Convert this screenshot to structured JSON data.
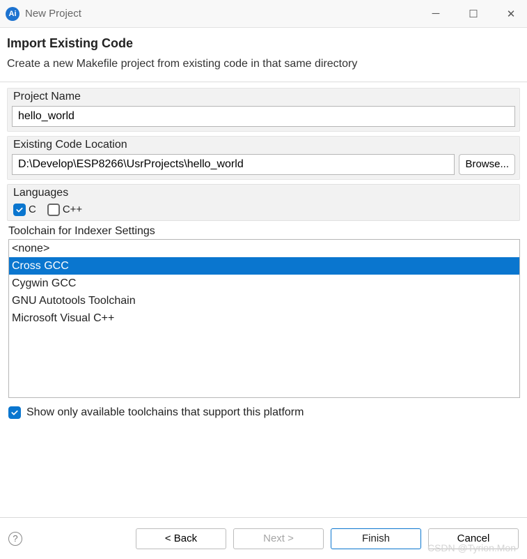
{
  "window": {
    "title": "New Project",
    "app_icon_text": "Ai"
  },
  "header": {
    "title": "Import Existing Code",
    "description": "Create a new Makefile project from existing code in that same directory"
  },
  "project_name": {
    "label": "Project Name",
    "value": "hello_world"
  },
  "existing_code": {
    "label": "Existing Code Location",
    "value": "D:\\Develop\\ESP8266\\UsrProjects\\hello_world",
    "browse_label": "Browse..."
  },
  "languages": {
    "label": "Languages",
    "items": [
      {
        "name": "c",
        "label": "C",
        "checked": true
      },
      {
        "name": "cpp",
        "label": "C++",
        "checked": false
      }
    ]
  },
  "toolchain": {
    "label": "Toolchain for Indexer Settings",
    "items": [
      {
        "label": "<none>",
        "selected": false
      },
      {
        "label": "Cross GCC",
        "selected": true
      },
      {
        "label": "Cygwin GCC",
        "selected": false
      },
      {
        "label": "GNU Autotools Toolchain",
        "selected": false
      },
      {
        "label": "Microsoft Visual C++",
        "selected": false
      }
    ]
  },
  "show_only": {
    "checked": true,
    "label": "Show only available toolchains that support this platform"
  },
  "footer": {
    "back": "< Back",
    "next": "Next >",
    "finish": "Finish",
    "cancel": "Cancel"
  },
  "watermark": "CSDN @Tyrion.Mon"
}
